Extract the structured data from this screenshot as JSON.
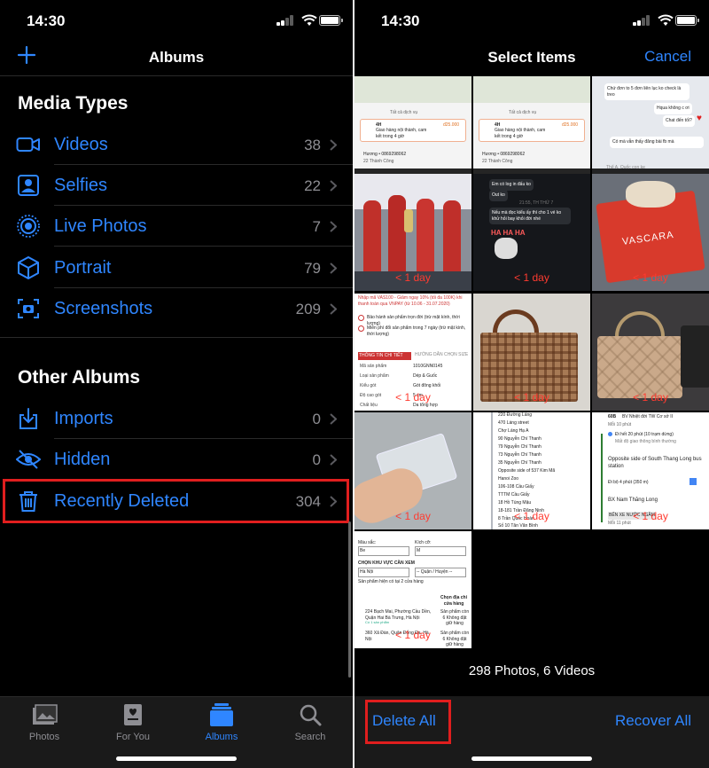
{
  "status": {
    "time": "14:30"
  },
  "albums": {
    "title": "Albums",
    "media_types": {
      "heading": "Media Types",
      "items": [
        {
          "label": "Videos",
          "count": "38"
        },
        {
          "label": "Selfies",
          "count": "22"
        },
        {
          "label": "Live Photos",
          "count": "7"
        },
        {
          "label": "Portrait",
          "count": "79"
        },
        {
          "label": "Screenshots",
          "count": "209"
        }
      ]
    },
    "other_albums": {
      "heading": "Other Albums",
      "items": [
        {
          "label": "Imports",
          "count": "0"
        },
        {
          "label": "Hidden",
          "count": "0"
        },
        {
          "label": "Recently Deleted",
          "count": "304"
        }
      ]
    },
    "tabs": [
      {
        "label": "Photos",
        "icon": "photos-icon",
        "active": false
      },
      {
        "label": "For You",
        "icon": "for-you-icon",
        "active": false
      },
      {
        "label": "Albums",
        "icon": "albums-icon",
        "active": true
      },
      {
        "label": "Search",
        "icon": "search-icon",
        "active": false
      }
    ]
  },
  "select": {
    "title": "Select Items",
    "cancel_label": "Cancel",
    "day_label": "< 1 day",
    "thumb1": {
      "service": "Tất cả dịch vụ",
      "badge": "4H",
      "desc": "Giao hàng nội thành, cam kết trong 4 giờ",
      "price": "đ25.000",
      "phone": "Hương • 0869298062",
      "addr": "22 Thành Công"
    },
    "thumb2": {
      "service": "Tất cả dịch vụ",
      "badge": "4H",
      "desc": "Giao hàng nội thành, cam kết trong 4 giờ",
      "price": "đ25.000",
      "phone": "Hương • 0869298062",
      "addr": "22 Thành Công"
    },
    "thumb3": {
      "m1": "Chứ đơn to 5 đơn liên lục ko check là treo",
      "m2": "Hqua không c ơi",
      "m3": "Chat đến tối? ",
      "m4": "Có mà vẫn thấy đăng bài fb mà",
      "m5": "Thể A. Quốc con ke"
    },
    "thumb5": {
      "m1": "Em có log in đấu ko",
      "m2": "Out ko",
      "time": "21:55, TH THỨ 7",
      "m3": "Nếu mà đọc kiểu ấy thì cho 1 vé ko khử hỏi bay khỏi đời nhé",
      "sticker": "HA HA HA"
    },
    "thumb6": {
      "brand": "VASCARA"
    },
    "thumb7": {
      "l1": "Nhập mã VAS100 - Giảm ngay 10% (tối đa 100K) khi thanh toán qua VNPAY (từ 10.06 - 31.07.2020)",
      "l2": "Bảo hành sản phẩm trọn đời (trừ mặt kính, thời lượng)",
      "l3": "Miễn phí đổi sản phẩm trong 7 ngày (trừ mặt kính, thời lượng)",
      "tab1": "THÔNG TIN CHI TIẾT",
      "tab2": "HƯỚNG DẪN CHỌN SIZE",
      "rows": [
        [
          "Mã sản phẩm",
          "1010GNN0145"
        ],
        [
          "Loại sản phẩm",
          "Dép & Guốc"
        ],
        [
          "Kiểu gót",
          "Gót đông khối"
        ],
        [
          "Độ cao gót",
          "5 cm"
        ],
        [
          "Chất liệu",
          "Da tổng hợp"
        ]
      ]
    },
    "thumb11": {
      "stops": [
        "220 Đường Láng",
        "470 Láng street",
        "Chợ Láng Hạ A",
        "90 Nguyễn Chí Thanh",
        "79 Nguyễn Chí Thanh",
        "73 Nguyễn Chí Thanh",
        "35 Nguyễn Chí Thanh",
        "Opposite side of 537 Kim Mã",
        "Hanoi Zoo",
        "106-108 Cầu Giấy",
        "TTTM Cầu Giấy",
        "18 Hồ Tùng Mậu",
        "18-181 Trần Đăng Ninh",
        "8 Trần Quốc Hoàn",
        "Số 10 Tân Văn Bình"
      ]
    },
    "thumb12": {
      "bus": "60B",
      "route": "BV Nhiệt đới TW Cơ sở II",
      "freq": "Mỗi 10 phút",
      "l1": "Đi hết 20 phút (10 trạm dừng)",
      "l2": "Mất độ giao thông bình thường",
      "l3": "Opposite side of South Thang Long bus station",
      "l4": "Đi bộ 4 phút (350 m)",
      "l5": "BX Nam Thăng Long",
      "l6": "BẾN XE NƯỚC NGẦM",
      "l7": "Mỗi 11 phút"
    },
    "thumb13": {
      "color_label": "Màu sắc:",
      "color_val": "Be",
      "size_label": "Kích cỡ:",
      "size_val": "M",
      "area": "CHỌN KHU VỰC CẦN XEM",
      "city": "Hà Nội",
      "district": "-- Quận / Huyện --",
      "note": "Sản phẩm hiện có tại 2 cửa hàng",
      "col": "Chọn địa chỉ cửa hàng",
      "s1": "224 Bạch Mai, Phường Cầu Dền, Quận Hai Bà Trưng, Hà Nội",
      "s1n": "Có 1 sản phẩm",
      "s1r": "Sản phẩm còn 6 Không đặt giữ hàng",
      "s2": "360 Xã Đàn, Quận Đống Đa, Hà Nội",
      "s2r": "Sản phẩm còn 6 Không đặt giữ hàng"
    },
    "summary": "298 Photos, 6 Videos",
    "delete_all_label": "Delete All",
    "recover_all_label": "Recover All"
  },
  "colors": {
    "accent": "#2f86ff",
    "highlight": "#e01e1e",
    "day_label": "#ff3b30"
  }
}
